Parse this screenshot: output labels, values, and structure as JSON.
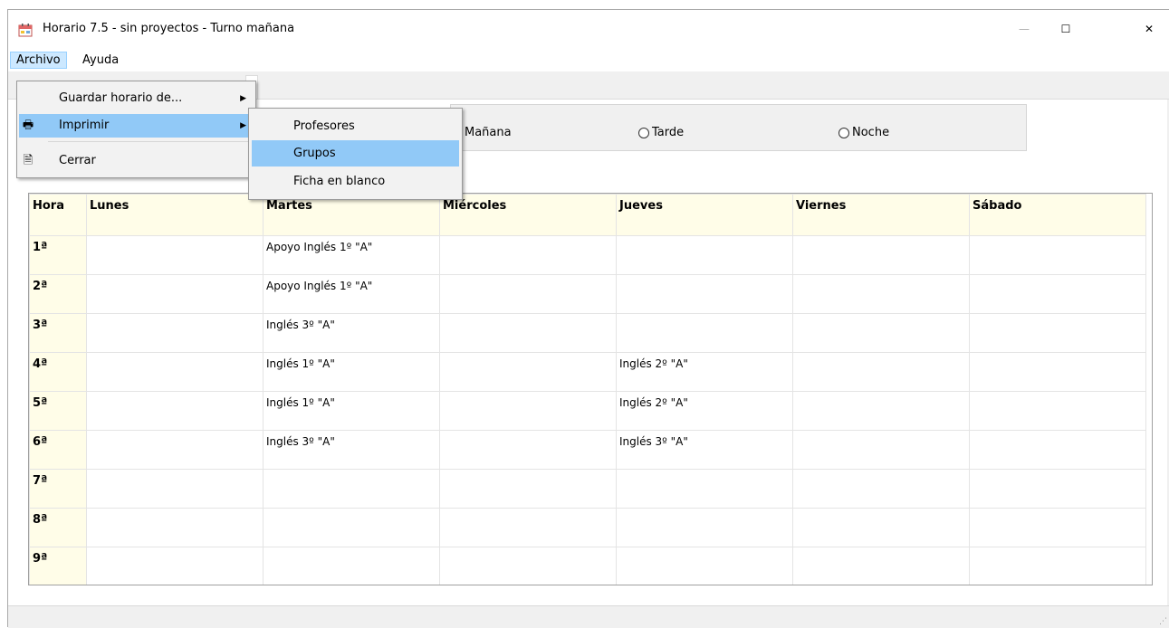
{
  "window": {
    "title": "Horario 7.5 - sin proyectos - Turno mañana"
  },
  "caption_buttons": {
    "minimize": "—",
    "maximize": "☐",
    "close": "✕"
  },
  "menubar": {
    "items": [
      {
        "label": "Archivo"
      },
      {
        "label": "Ayuda"
      }
    ]
  },
  "archivo_menu": {
    "items": [
      {
        "label": "Guardar horario de...",
        "has_submenu": true
      },
      {
        "label": "Imprimir",
        "icon": "printer-icon",
        "has_submenu": true,
        "highlighted": true
      },
      {
        "label": "Cerrar",
        "icon": "close-document-icon"
      }
    ]
  },
  "imprimir_submenu": {
    "items": [
      {
        "label": "Profesores"
      },
      {
        "label": "Grupos",
        "highlighted": true
      },
      {
        "label": "Ficha en blanco"
      }
    ]
  },
  "turno": {
    "options": [
      {
        "label": "Mañana",
        "checked": false
      },
      {
        "label": "Tarde",
        "checked": false
      },
      {
        "label": "Noche",
        "checked": false
      }
    ]
  },
  "schedule": {
    "headers": [
      "Hora",
      "Lunes",
      "Martes",
      "Miércoles",
      "Jueves",
      "Viernes",
      "Sábado"
    ],
    "rows": [
      {
        "hour": "1ª",
        "cells": [
          "",
          "Apoyo Inglés 1º \"A\"",
          "",
          "",
          "",
          ""
        ]
      },
      {
        "hour": "2ª",
        "cells": [
          "",
          "Apoyo Inglés 1º \"A\"",
          "",
          "",
          "",
          ""
        ]
      },
      {
        "hour": "3ª",
        "cells": [
          "",
          "Inglés 3º \"A\"",
          "",
          "",
          "",
          ""
        ]
      },
      {
        "hour": "4ª",
        "cells": [
          "",
          "Inglés 1º \"A\"",
          "",
          "Inglés 2º \"A\"",
          "",
          ""
        ]
      },
      {
        "hour": "5ª",
        "cells": [
          "",
          "Inglés 1º \"A\"",
          "",
          "Inglés 2º \"A\"",
          "",
          ""
        ]
      },
      {
        "hour": "6ª",
        "cells": [
          "",
          "Inglés 3º \"A\"",
          "",
          "Inglés 3º \"A\"",
          "",
          ""
        ]
      },
      {
        "hour": "7ª",
        "cells": [
          "",
          "",
          "",
          "",
          "",
          ""
        ]
      },
      {
        "hour": "8ª",
        "cells": [
          "",
          "",
          "",
          "",
          "",
          ""
        ]
      },
      {
        "hour": "9ª",
        "cells": [
          "",
          "",
          "",
          "",
          "",
          ""
        ]
      }
    ]
  },
  "colors": {
    "header_bg": "#fffde8",
    "menu_highlight": "#91c9f7",
    "menubar_selected": "#cce8ff"
  }
}
